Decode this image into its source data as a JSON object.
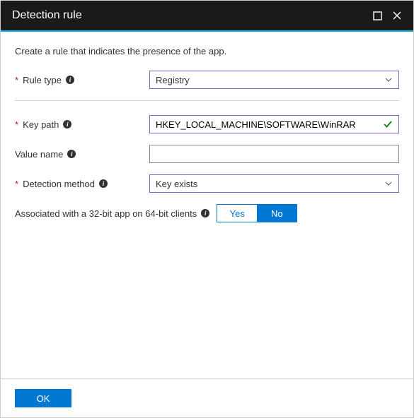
{
  "header": {
    "title": "Detection rule"
  },
  "subtitle": "Create a rule that indicates the presence of the app.",
  "form": {
    "ruleType": {
      "label": "Rule type",
      "value": "Registry",
      "required": true
    },
    "keyPath": {
      "label": "Key path",
      "value": "HKEY_LOCAL_MACHINE\\SOFTWARE\\WinRAR",
      "required": true
    },
    "valueName": {
      "label": "Value name",
      "value": "",
      "required": false
    },
    "detectionMethod": {
      "label": "Detection method",
      "value": "Key exists",
      "required": true
    },
    "assoc32": {
      "label": "Associated with a 32-bit app on 64-bit clients",
      "yes": "Yes",
      "no": "No",
      "selected": "No"
    }
  },
  "footer": {
    "ok": "OK"
  }
}
